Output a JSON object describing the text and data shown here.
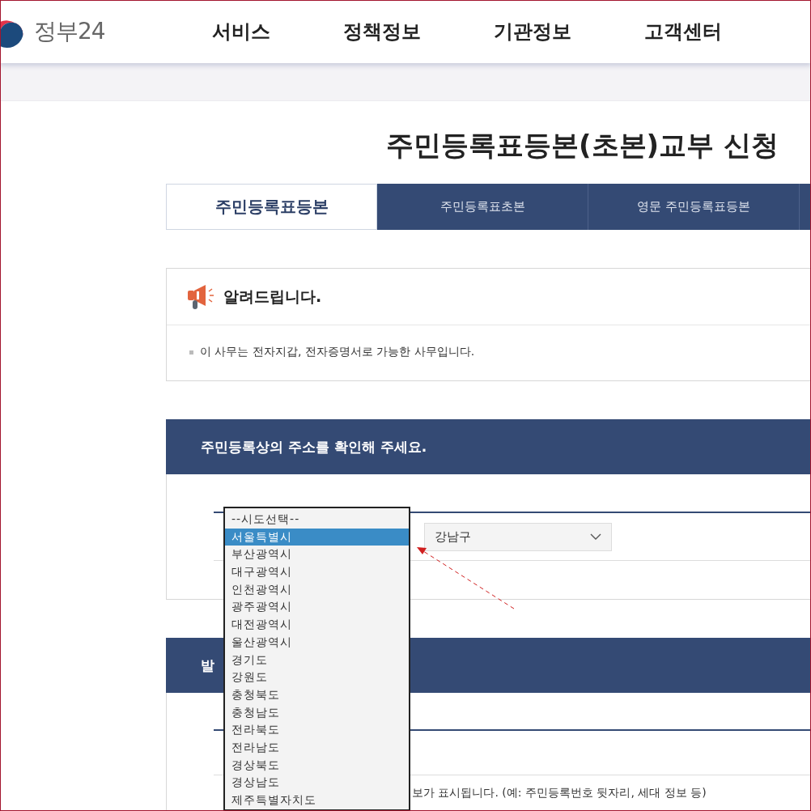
{
  "header": {
    "logo": "정부24",
    "nav": [
      "서비스",
      "정책정보",
      "기관정보",
      "고객센터"
    ]
  },
  "page_title": "주민등록표등본(초본)교부 신청",
  "tabs": [
    {
      "label": "주민등록표등본",
      "selected": true
    },
    {
      "label": "주민등록표초본",
      "selected": false
    },
    {
      "label": "영문 주민등록표등본",
      "selected": false
    }
  ],
  "notice": {
    "title": "알려드립니다.",
    "items": [
      "이 사무는 전자지갑, 전자증명서로 가능한 사무입니다."
    ]
  },
  "address_section": {
    "title": "주민등록상의 주소를 확인해 주세요.",
    "district_select": {
      "value": "강남구"
    }
  },
  "region_dropdown": {
    "options": [
      {
        "label": "--시도선택--",
        "selected": false
      },
      {
        "label": "서울특별시",
        "selected": true
      },
      {
        "label": "부산광역시",
        "selected": false
      },
      {
        "label": "대구광역시",
        "selected": false
      },
      {
        "label": "인천광역시",
        "selected": false
      },
      {
        "label": "광주광역시",
        "selected": false
      },
      {
        "label": "대전광역시",
        "selected": false
      },
      {
        "label": "울산광역시",
        "selected": false
      },
      {
        "label": "경기도",
        "selected": false
      },
      {
        "label": "강원도",
        "selected": false
      },
      {
        "label": "충청북도",
        "selected": false
      },
      {
        "label": "충청남도",
        "selected": false
      },
      {
        "label": "전라북도",
        "selected": false
      },
      {
        "label": "전라남도",
        "selected": false
      },
      {
        "label": "경상북도",
        "selected": false
      },
      {
        "label": "경상남도",
        "selected": false
      },
      {
        "label": "제주특별자치도",
        "selected": false
      }
    ]
  },
  "issue_section": {
    "title": "발",
    "note": "보가 표시됩니다. (예: 주민등록번호 뒷자리, 세대 정보 등)"
  }
}
